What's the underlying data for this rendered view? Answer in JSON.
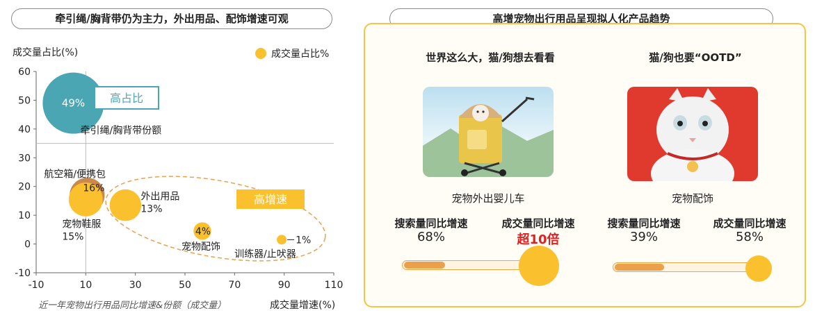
{
  "left_header": "牵引绳/胸背带仍为主力，外出用品、配饰增速可观",
  "right_header": "高增宠物出行用品呈现拟人化产品趋势",
  "chart_data": {
    "type": "scatter",
    "title": "近一年宠物出行用品同比增速&份额（成交量）",
    "xlabel": "成交量增速(%)",
    "ylabel": "成交量占比(%)",
    "legend": {
      "label": "成交量占比%",
      "position": "top-right"
    },
    "xlim": [
      -10,
      110
    ],
    "ylim": [
      -10,
      60
    ],
    "xticks": [
      "-10",
      "10",
      "30",
      "50",
      "70",
      "90",
      "110"
    ],
    "yticks": [
      "60",
      "50",
      "40",
      "30",
      "20",
      "10",
      "0",
      "-10"
    ],
    "reference_lines": {
      "x": 10,
      "y": 35
    },
    "points": [
      {
        "name": "牵引绳/胸背带份额",
        "x": 5,
        "y": 49,
        "share": "49%",
        "color": "#4aa6b3"
      },
      {
        "name": "航空箱/便携包",
        "x": 10,
        "y": 16,
        "share": "16%",
        "color": "#c98a4b"
      },
      {
        "name": "宠物鞋服",
        "x": 10,
        "y": 15.5,
        "share": "15%",
        "color": "#fbc02d"
      },
      {
        "name": "外出用品",
        "x": 26,
        "y": 13.5,
        "share": "13%",
        "color": "#fbc02d"
      },
      {
        "name": "宠物配饰",
        "x": 57,
        "y": 4.5,
        "share": "4%",
        "color": "#fbc02d"
      },
      {
        "name": "训练器/止吠器",
        "x": 89,
        "y": 1.5,
        "share": "1%",
        "color": "#fbc02d"
      }
    ],
    "annotations": {
      "high_share": "高占比",
      "high_growth": "高增速"
    }
  },
  "products": [
    {
      "subtitle": "世界这么大，猫/狗想去看看",
      "caption": "宠物外出婴儿车",
      "metrics": [
        {
          "label": "搜索量同比增速",
          "value": "68%"
        },
        {
          "label": "成交量同比增速",
          "value": "超10倍",
          "highlight": true
        }
      ],
      "progress": 0.29
    },
    {
      "subtitle": "猫/狗也要“OOTD”",
      "caption": "宠物配饰",
      "metrics": [
        {
          "label": "搜索量同比增速",
          "value": "39%"
        },
        {
          "label": "成交量同比增速",
          "value": "58%"
        }
      ],
      "progress": 0.35
    }
  ]
}
